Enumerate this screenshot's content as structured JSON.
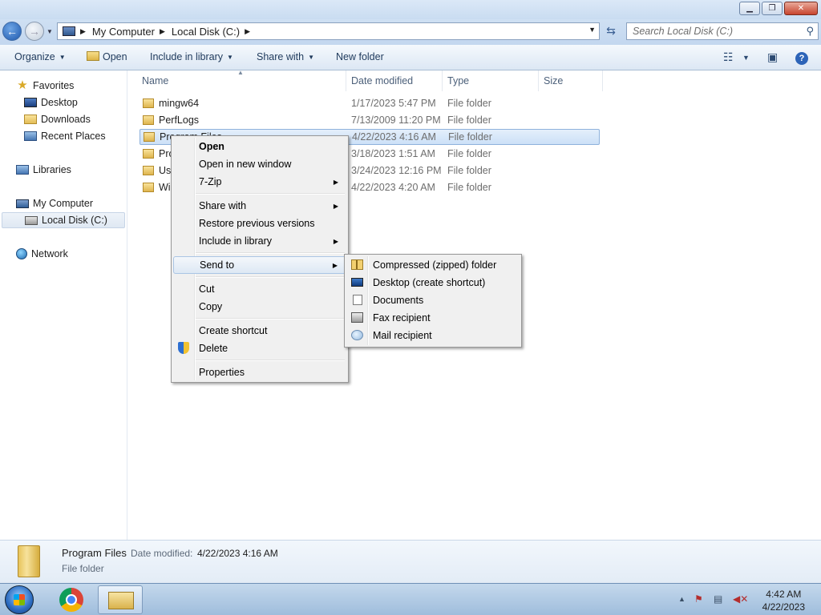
{
  "window": {
    "minimize": "▁",
    "maximize": "❐",
    "close": "✕"
  },
  "address": {
    "crumbs": [
      "My Computer",
      "Local Disk (C:)"
    ],
    "search_placeholder": "Search Local Disk (C:)"
  },
  "toolbar": {
    "organize": "Organize",
    "open": "Open",
    "include_in_library": "Include in library",
    "share_with": "Share with",
    "new_folder": "New folder"
  },
  "nav": {
    "favorites": "Favorites",
    "desktop": "Desktop",
    "downloads": "Downloads",
    "recent_places": "Recent Places",
    "libraries": "Libraries",
    "my_computer": "My Computer",
    "local_disk": "Local Disk (C:)",
    "network": "Network"
  },
  "columns": {
    "name": "Name",
    "date_modified": "Date modified",
    "type": "Type",
    "size": "Size"
  },
  "files": [
    {
      "name": "mingw64",
      "date": "1/17/2023 5:47 PM",
      "type": "File folder"
    },
    {
      "name": "PerfLogs",
      "date": "7/13/2009 11:20 PM",
      "type": "File folder"
    },
    {
      "name": "Program Files",
      "date": "4/22/2023 4:16 AM",
      "type": "File folder"
    },
    {
      "name": "Pro",
      "date": "3/18/2023 1:51 AM",
      "type": "File folder"
    },
    {
      "name": "Us",
      "date": "3/24/2023 12:16 PM",
      "type": "File folder"
    },
    {
      "name": "Wi",
      "date": "4/22/2023 4:20 AM",
      "type": "File folder"
    }
  ],
  "context_menu": {
    "open": "Open",
    "open_new_window": "Open in new window",
    "seven_zip": "7-Zip",
    "share_with": "Share with",
    "restore_previous": "Restore previous versions",
    "include_in_library": "Include in library",
    "send_to": "Send to",
    "cut": "Cut",
    "copy": "Copy",
    "create_shortcut": "Create shortcut",
    "delete": "Delete",
    "properties": "Properties"
  },
  "send_to_menu": {
    "compressed": "Compressed (zipped) folder",
    "desktop_shortcut": "Desktop (create shortcut)",
    "documents": "Documents",
    "fax": "Fax recipient",
    "mail": "Mail recipient"
  },
  "details": {
    "name": "Program Files",
    "date_label": "Date modified:",
    "date_value": "4/22/2023 4:16 AM",
    "type": "File folder"
  },
  "taskbar": {
    "time": "4:42 AM",
    "date": "4/22/2023"
  }
}
